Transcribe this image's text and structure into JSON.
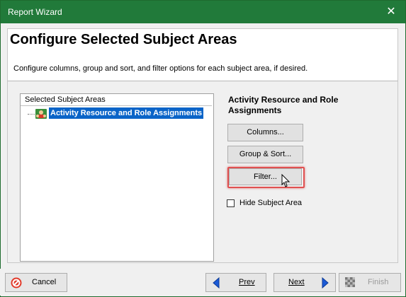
{
  "window": {
    "title": "Report Wizard",
    "close_glyph": "✕"
  },
  "header": {
    "title": "Configure Selected Subject Areas",
    "description": "Configure columns, group and sort, and filter options for each subject area, if desired."
  },
  "tree": {
    "column_header": "Selected Subject Areas",
    "items": [
      {
        "label": "Activity Resource and Role Assignments",
        "icon": "user-group-icon",
        "selected": true
      }
    ]
  },
  "selection": {
    "heading_line1": "Activity Resource and Role",
    "heading_line2": "Assignments"
  },
  "buttons": {
    "columns": "Columns...",
    "group_sort": "Group & Sort...",
    "filter": "Filter..."
  },
  "options": {
    "hide_subject_area_label": "Hide Subject Area",
    "hide_subject_area_checked": false
  },
  "footer": {
    "cancel": "Cancel",
    "prev": "Prev",
    "next": "Next",
    "finish": "Finish"
  },
  "colors": {
    "titlebar": "#217a3a",
    "selection": "#0a64c8",
    "highlight": "#e05050"
  }
}
